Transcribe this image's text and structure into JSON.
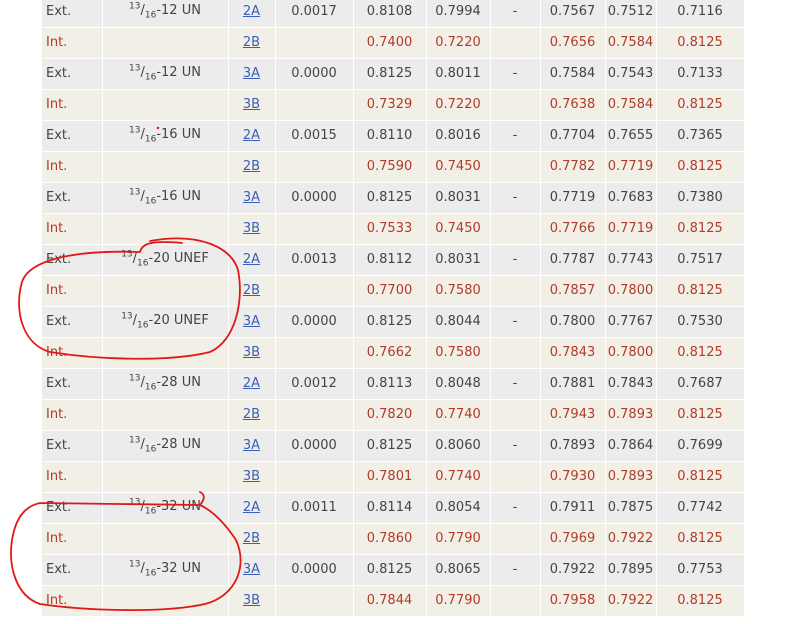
{
  "rows": [
    {
      "type": "Ext.",
      "num": "13",
      "den": "16",
      "series": "-12 UN",
      "cls": "2A",
      "allowance": "0.0017",
      "v1": "0.8108",
      "v2": "0.7994",
      "v3": "-",
      "v4": "0.7567",
      "v5": "0.7512",
      "v6": "0.7116"
    },
    {
      "type": "Int.",
      "num": "",
      "den": "",
      "series": "",
      "cls": "2B",
      "allowance": "",
      "v1": "0.7400",
      "v2": "0.7220",
      "v3": "",
      "v4": "0.7656",
      "v5": "0.7584",
      "v6": "0.8125"
    },
    {
      "type": "Ext.",
      "num": "13",
      "den": "16",
      "series": "-12 UN",
      "cls": "3A",
      "allowance": "0.0000",
      "v1": "0.8125",
      "v2": "0.8011",
      "v3": "-",
      "v4": "0.7584",
      "v5": "0.7543",
      "v6": "0.7133"
    },
    {
      "type": "Int.",
      "num": "",
      "den": "",
      "series": "",
      "cls": "3B",
      "allowance": "",
      "v1": "0.7329",
      "v2": "0.7220",
      "v3": "",
      "v4": "0.7638",
      "v5": "0.7584",
      "v6": "0.8125"
    },
    {
      "type": "Ext.",
      "num": "13",
      "den": "16",
      "series": "-16 UN",
      "cls": "2A",
      "allowance": "0.0015",
      "v1": "0.8110",
      "v2": "0.8016",
      "v3": "-",
      "v4": "0.7704",
      "v5": "0.7655",
      "v6": "0.7365"
    },
    {
      "type": "Int.",
      "num": "",
      "den": "",
      "series": "",
      "cls": "2B",
      "allowance": "",
      "v1": "0.7590",
      "v2": "0.7450",
      "v3": "",
      "v4": "0.7782",
      "v5": "0.7719",
      "v6": "0.8125"
    },
    {
      "type": "Ext.",
      "num": "13",
      "den": "16",
      "series": "-16 UN",
      "cls": "3A",
      "allowance": "0.0000",
      "v1": "0.8125",
      "v2": "0.8031",
      "v3": "-",
      "v4": "0.7719",
      "v5": "0.7683",
      "v6": "0.7380"
    },
    {
      "type": "Int.",
      "num": "",
      "den": "",
      "series": "",
      "cls": "3B",
      "allowance": "",
      "v1": "0.7533",
      "v2": "0.7450",
      "v3": "",
      "v4": "0.7766",
      "v5": "0.7719",
      "v6": "0.8125"
    },
    {
      "type": "Ext.",
      "num": "13",
      "den": "16",
      "series": "-20 UNEF",
      "cls": "2A",
      "allowance": "0.0013",
      "v1": "0.8112",
      "v2": "0.8031",
      "v3": "-",
      "v4": "0.7787",
      "v5": "0.7743",
      "v6": "0.7517"
    },
    {
      "type": "Int.",
      "num": "",
      "den": "",
      "series": "",
      "cls": "2B",
      "allowance": "",
      "v1": "0.7700",
      "v2": "0.7580",
      "v3": "",
      "v4": "0.7857",
      "v5": "0.7800",
      "v6": "0.8125"
    },
    {
      "type": "Ext.",
      "num": "13",
      "den": "16",
      "series": "-20 UNEF",
      "cls": "3A",
      "allowance": "0.0000",
      "v1": "0.8125",
      "v2": "0.8044",
      "v3": "-",
      "v4": "0.7800",
      "v5": "0.7767",
      "v6": "0.7530"
    },
    {
      "type": "Int.",
      "num": "",
      "den": "",
      "series": "",
      "cls": "3B",
      "allowance": "",
      "v1": "0.7662",
      "v2": "0.7580",
      "v3": "",
      "v4": "0.7843",
      "v5": "0.7800",
      "v6": "0.8125"
    },
    {
      "type": "Ext.",
      "num": "13",
      "den": "16",
      "series": "-28 UN",
      "cls": "2A",
      "allowance": "0.0012",
      "v1": "0.8113",
      "v2": "0.8048",
      "v3": "-",
      "v4": "0.7881",
      "v5": "0.7843",
      "v6": "0.7687"
    },
    {
      "type": "Int.",
      "num": "",
      "den": "",
      "series": "",
      "cls": "2B",
      "allowance": "",
      "v1": "0.7820",
      "v2": "0.7740",
      "v3": "",
      "v4": "0.7943",
      "v5": "0.7893",
      "v6": "0.8125"
    },
    {
      "type": "Ext.",
      "num": "13",
      "den": "16",
      "series": "-28 UN",
      "cls": "3A",
      "allowance": "0.0000",
      "v1": "0.8125",
      "v2": "0.8060",
      "v3": "-",
      "v4": "0.7893",
      "v5": "0.7864",
      "v6": "0.7699"
    },
    {
      "type": "Int.",
      "num": "",
      "den": "",
      "series": "",
      "cls": "3B",
      "allowance": "",
      "v1": "0.7801",
      "v2": "0.7740",
      "v3": "",
      "v4": "0.7930",
      "v5": "0.7893",
      "v6": "0.8125"
    },
    {
      "type": "Ext.",
      "num": "13",
      "den": "16",
      "series": "-32 UN",
      "cls": "2A",
      "allowance": "0.0011",
      "v1": "0.8114",
      "v2": "0.8054",
      "v3": "-",
      "v4": "0.7911",
      "v5": "0.7875",
      "v6": "0.7742"
    },
    {
      "type": "Int.",
      "num": "",
      "den": "",
      "series": "",
      "cls": "2B",
      "allowance": "",
      "v1": "0.7860",
      "v2": "0.7790",
      "v3": "",
      "v4": "0.7969",
      "v5": "0.7922",
      "v6": "0.8125"
    },
    {
      "type": "Ext.",
      "num": "13",
      "den": "16",
      "series": "-32 UN",
      "cls": "3A",
      "allowance": "0.0000",
      "v1": "0.8125",
      "v2": "0.8065",
      "v3": "-",
      "v4": "0.7922",
      "v5": "0.7895",
      "v6": "0.7753"
    },
    {
      "type": "Int.",
      "num": "",
      "den": "",
      "series": "",
      "cls": "3B",
      "allowance": "",
      "v1": "0.7844",
      "v2": "0.7790",
      "v3": "",
      "v4": "0.7958",
      "v5": "0.7922",
      "v6": "0.8125"
    }
  ],
  "colors": {
    "ext_row_bg": "#ececec",
    "int_row_bg": "#f2f0e6",
    "ext_text": "#444444",
    "int_text": "#b23a2a",
    "link": "#3a5fb8",
    "annotation": "#e01818"
  }
}
